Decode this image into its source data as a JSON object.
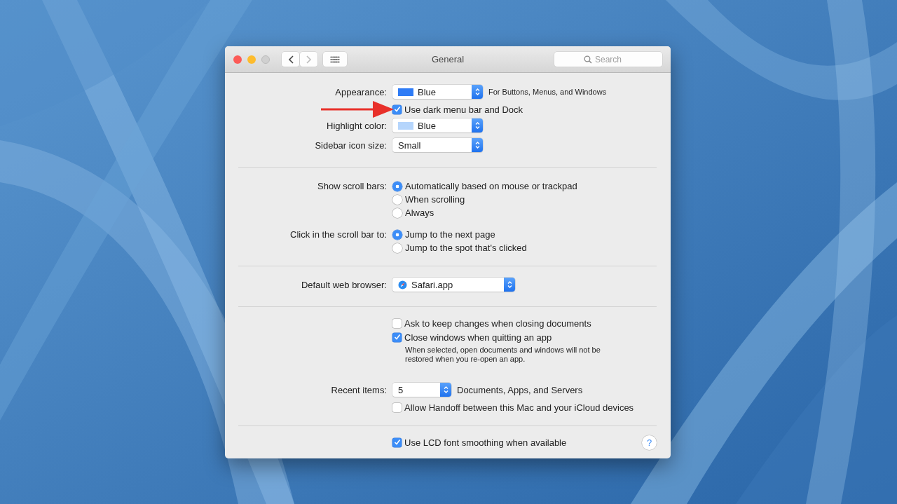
{
  "window": {
    "title": "General",
    "search": {
      "placeholder": "Search"
    }
  },
  "sections": [
    [
      {
        "kind": "select",
        "label": "Appearance:",
        "value": "Blue",
        "color": "#2f7cf6",
        "note": "For Buttons, Menus, and Windows"
      },
      {
        "kind": "checkbox",
        "text": "Use dark menu bar and Dock",
        "checked": true,
        "annotated": true
      },
      {
        "kind": "select",
        "label": "Highlight color:",
        "value": "Blue",
        "color": "#b5d5fc"
      },
      {
        "kind": "select",
        "label": "Sidebar icon size:",
        "value": "Small"
      }
    ],
    [
      {
        "kind": "radio",
        "label": "Show scroll bars:",
        "options": [
          {
            "text": "Automatically based on mouse or trackpad",
            "selected": true
          },
          {
            "text": "When scrolling",
            "selected": false
          },
          {
            "text": "Always",
            "selected": false
          }
        ]
      },
      {
        "kind": "radio",
        "label": "Click in the scroll bar to:",
        "options": [
          {
            "text": "Jump to the next page",
            "selected": true
          },
          {
            "text": "Jump to the spot that's clicked",
            "selected": false
          }
        ]
      }
    ],
    [
      {
        "kind": "app-select",
        "label": "Default web browser:",
        "value": "Safari.app"
      }
    ],
    [
      {
        "kind": "checkbox",
        "text": "Ask to keep changes when closing documents",
        "checked": false
      },
      {
        "kind": "checkbox",
        "text": "Close windows when quitting an app",
        "checked": true,
        "hint": "When selected, open documents and windows will not be restored when you re-open an app."
      },
      {
        "kind": "number-select",
        "label": "Recent items:",
        "value": "5",
        "note": "Documents, Apps, and Servers"
      },
      {
        "kind": "checkbox",
        "text": "Allow Handoff between this Mac and your iCloud devices",
        "checked": false
      }
    ],
    [
      {
        "kind": "checkbox",
        "text": "Use LCD font smoothing when available",
        "checked": true,
        "help": "?"
      }
    ]
  ]
}
